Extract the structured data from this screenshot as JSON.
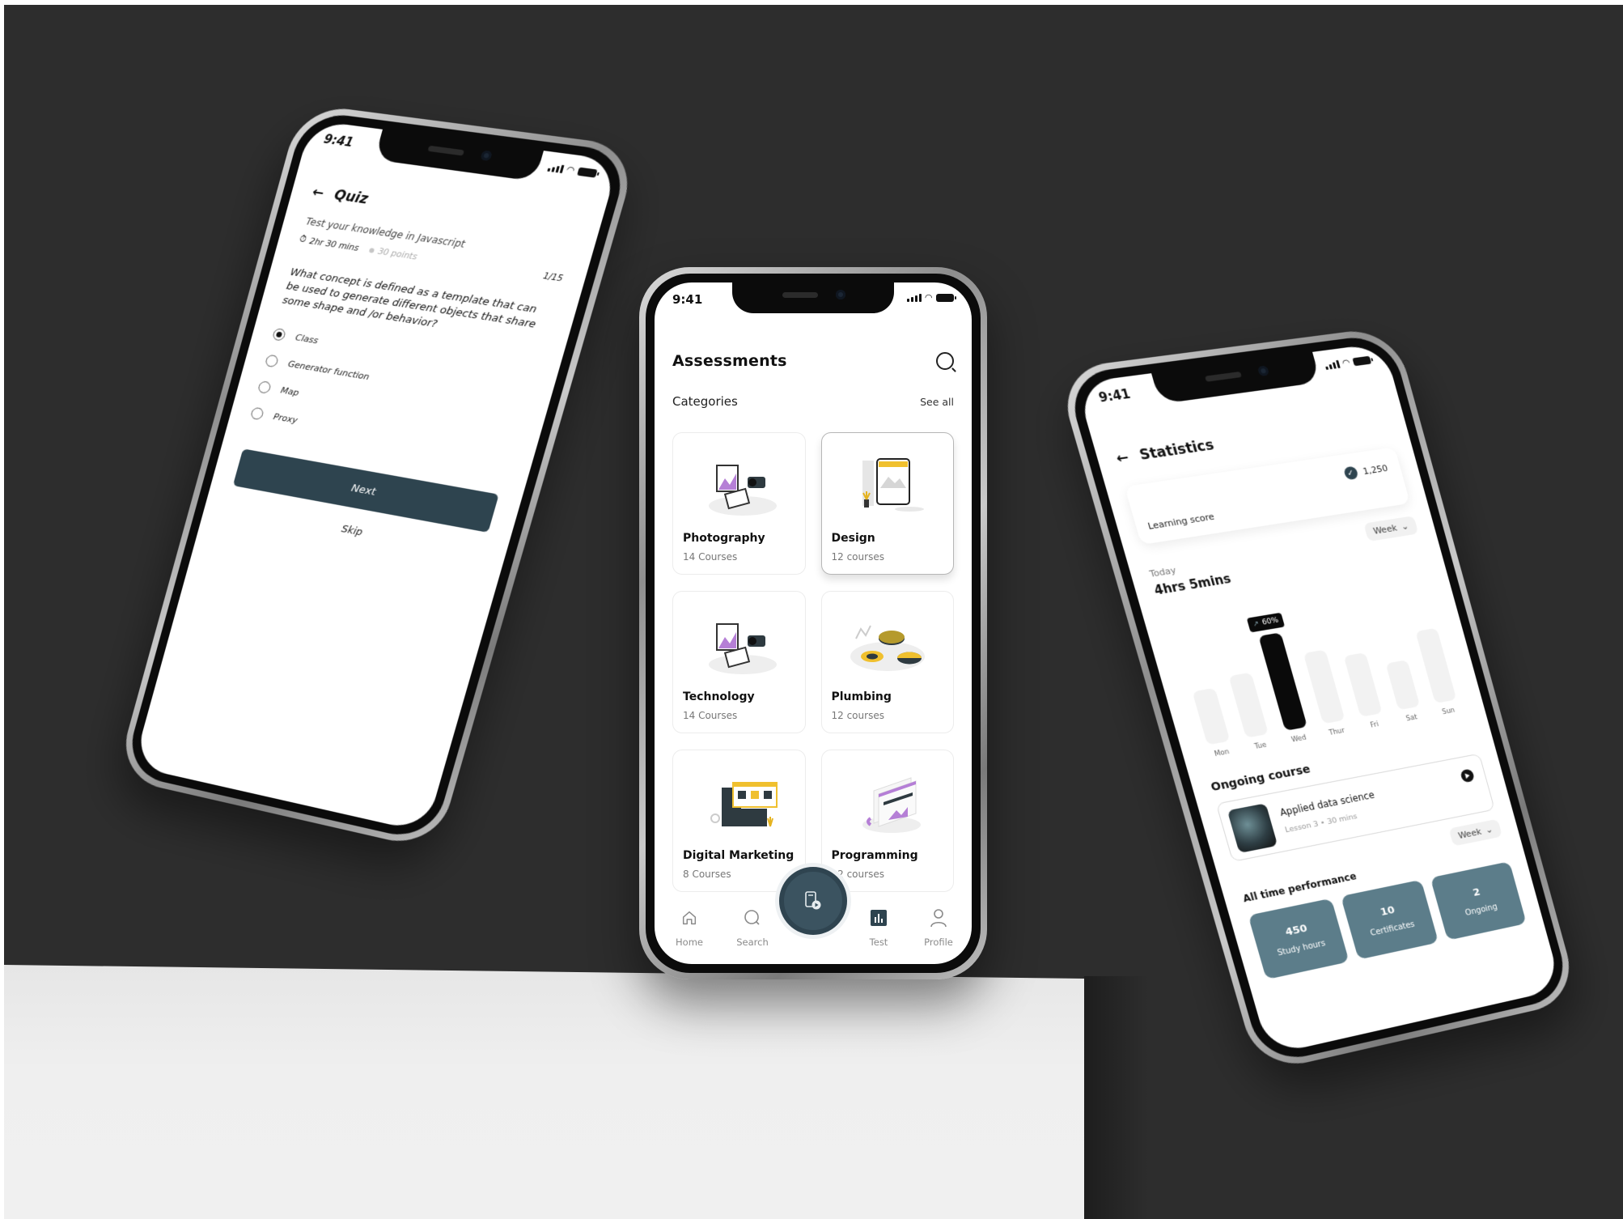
{
  "status_bar": {
    "time": "9:41"
  },
  "assessments_screen": {
    "title": "Assessments",
    "categories_label": "Categories",
    "see_all_label": "See all",
    "categories": [
      {
        "name": "Photography",
        "count": "14 Courses",
        "illustration": "photography-illustration",
        "selected": false
      },
      {
        "name": "Design",
        "count": "12 courses",
        "illustration": "design-illustration",
        "selected": true
      },
      {
        "name": "Technology",
        "count": "14 Courses",
        "illustration": "technology-illustration",
        "selected": false
      },
      {
        "name": "Plumbing",
        "count": "12 courses",
        "illustration": "plumbing-illustration",
        "selected": false
      },
      {
        "name": "Digital Marketing",
        "count": "8 Courses",
        "illustration": "digital-marketing-illustration",
        "selected": false
      },
      {
        "name": "Programming",
        "count": "12 courses",
        "illustration": "programming-illustration",
        "selected": false
      }
    ],
    "tab_bar": {
      "items": [
        {
          "label": "Home",
          "icon": "home-icon"
        },
        {
          "label": "Search",
          "icon": "search-icon"
        },
        {
          "label": "",
          "icon": "test-play-icon",
          "center": true
        },
        {
          "label": "Test",
          "icon": "bar-chart-icon",
          "active": true
        },
        {
          "label": "Profile",
          "icon": "user-icon"
        }
      ]
    }
  },
  "quiz_screen": {
    "title": "Quiz",
    "subtitle": "Test your knowledge in Javascript",
    "duration": "2hr 30 mins",
    "points": "30 points",
    "progress": "1/15",
    "question": "What concept is defined as a template that can be used to generate different objects that share some shape and /or behavior?",
    "options": [
      {
        "label": "Class",
        "selected": true
      },
      {
        "label": "Generator function",
        "selected": false
      },
      {
        "label": "Map",
        "selected": false
      },
      {
        "label": "Proxy",
        "selected": false
      }
    ],
    "next_label": "Next",
    "skip_label": "Skip"
  },
  "statistics_screen": {
    "title": "Statistics",
    "learning_score_label": "Learning score",
    "learning_score_value": "1,250",
    "period_select": "Week",
    "today_label": "Today",
    "today_value": "4hrs 5mins",
    "chart_data": {
      "type": "bar",
      "categories": [
        "Mon",
        "Tue",
        "Wed",
        "Thur",
        "Fri",
        "Sat",
        "Sun"
      ],
      "values": [
        0.45,
        0.52,
        0.8,
        0.6,
        0.52,
        0.4,
        0.62
      ],
      "highlighted": "Wed",
      "tooltip": "60%",
      "colors": {
        "active": "#0a0a0a",
        "inactive": "#f2f2f2"
      }
    },
    "ongoing_title": "Ongoing course",
    "ongoing_course": {
      "name": "Applied data science",
      "meta": "Lesson 3 • 30 mins"
    },
    "performance_period_select": "Week",
    "performance_title": "All time performance",
    "performance": [
      {
        "value": "450",
        "label": "Study hours"
      },
      {
        "value": "10",
        "label": "Certificates"
      },
      {
        "value": "2",
        "label": "Ongoing"
      }
    ],
    "accent_color": "#5c7d8a"
  },
  "colors": {
    "primary_dark": "#2e444f",
    "background": "#2d2d2d"
  }
}
